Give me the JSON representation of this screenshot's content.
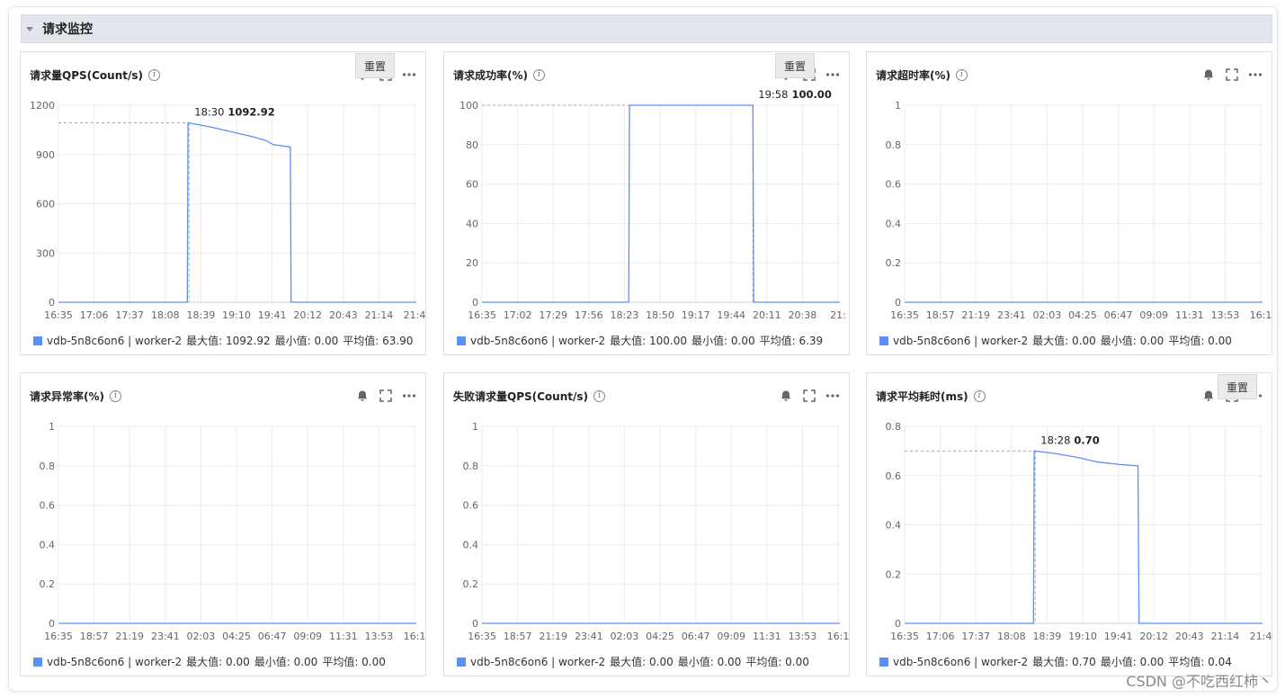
{
  "section": {
    "title": "请求监控"
  },
  "toolbar": {
    "icons": [
      "bell-icon",
      "fullscreen-icon",
      "more-icon"
    ]
  },
  "colors": {
    "series": "#5b8ff9",
    "grid": "#ebebeb",
    "axis": "#666666",
    "ref": "#aaaaaa"
  },
  "watermark": "CSDN @不吃西红柿丶",
  "panels": [
    {
      "title": "请求量QPS(Count/s)",
      "legend": {
        "series": "vdb-5n8c6on6 | worker-2",
        "max": "最大值: 1092.92",
        "min": "最小值: 0.00",
        "avg": "平均值: 63.90"
      },
      "reset": "重置",
      "tooltip": {
        "time": "18:30",
        "value": "1092.92"
      }
    },
    {
      "title": "请求成功率(%)",
      "legend": {
        "series": "vdb-5n8c6on6 | worker-2",
        "max": "最大值: 100.00",
        "min": "最小值: 0.00",
        "avg": "平均值: 6.39"
      },
      "reset": "重置",
      "tooltip": {
        "time": "19:58",
        "value": "100.00"
      }
    },
    {
      "title": "请求超时率(%)",
      "legend": {
        "series": "vdb-5n8c6on6 | worker-2",
        "max": "最大值: 0.00",
        "min": "最小值: 0.00",
        "avg": "平均值: 0.00"
      }
    },
    {
      "title": "请求异常率(%)",
      "legend": {
        "series": "vdb-5n8c6on6 | worker-2",
        "max": "最大值: 0.00",
        "min": "最小值: 0.00",
        "avg": "平均值: 0.00"
      }
    },
    {
      "title": "失败请求量QPS(Count/s)",
      "legend": {
        "series": "vdb-5n8c6on6 | worker-2",
        "max": "最大值: 0.00",
        "min": "最小值: 0.00",
        "avg": "平均值: 0.00"
      }
    },
    {
      "title": "请求平均耗时(ms)",
      "legend": {
        "series": "vdb-5n8c6on6 | worker-2",
        "max": "最大值: 0.70",
        "min": "最小值: 0.00",
        "avg": "平均值: 0.04"
      },
      "reset": "重置",
      "tooltip": {
        "time": "18:28",
        "value": "0.70"
      }
    }
  ],
  "chart_data": [
    {
      "type": "line",
      "title": "请求量QPS(Count/s)",
      "x": [
        "16:35",
        "17:06",
        "17:37",
        "18:08",
        "18:39",
        "19:10",
        "19:41",
        "20:12",
        "20:43",
        "21:14",
        "21:4"
      ],
      "yticks": [
        "0",
        "300",
        "600",
        "900",
        "1200"
      ],
      "ylim": [
        0,
        1200
      ],
      "series": [
        {
          "name": "vdb-5n8c6on6 | worker-2",
          "points": [
            [
              0,
              0
            ],
            [
              0.36,
              0
            ],
            [
              0.362,
              1092.92
            ],
            [
              0.42,
              1070
            ],
            [
              0.48,
              1040
            ],
            [
              0.54,
              1010
            ],
            [
              0.58,
              985
            ],
            [
              0.6,
              960
            ],
            [
              0.648,
              945
            ],
            [
              0.65,
              0
            ],
            [
              1,
              0
            ]
          ]
        }
      ],
      "ref": {
        "x": 0.365,
        "y": 1092.92
      }
    },
    {
      "type": "line",
      "title": "请求成功率(%)",
      "x": [
        "16:35",
        "17:02",
        "17:29",
        "17:56",
        "18:23",
        "18:50",
        "19:17",
        "19:44",
        "20:11",
        "20:38",
        "21:"
      ],
      "yticks": [
        "0",
        "20",
        "40",
        "60",
        "80",
        "100"
      ],
      "ylim": [
        0,
        100
      ],
      "series": [
        {
          "name": "vdb-5n8c6on6 | worker-2",
          "points": [
            [
              0,
              0
            ],
            [
              0.41,
              0
            ],
            [
              0.412,
              100
            ],
            [
              0.757,
              100
            ],
            [
              0.759,
              0
            ],
            [
              1,
              0
            ]
          ]
        }
      ],
      "ref": {
        "x": 0.757,
        "y": 100
      }
    },
    {
      "type": "line",
      "title": "请求超时率(%)",
      "x": [
        "16:35",
        "18:57",
        "21:19",
        "23:41",
        "02:03",
        "04:25",
        "06:47",
        "09:09",
        "11:31",
        "13:53",
        "16:1"
      ],
      "yticks": [
        "0",
        "0.2",
        "0.4",
        "0.6",
        "0.8",
        "1"
      ],
      "ylim": [
        0,
        1
      ],
      "series": [
        {
          "name": "vdb-5n8c6on6 | worker-2",
          "points": [
            [
              0,
              0
            ],
            [
              1,
              0
            ]
          ]
        }
      ]
    },
    {
      "type": "line",
      "title": "请求异常率(%)",
      "x": [
        "16:35",
        "18:57",
        "21:19",
        "23:41",
        "02:03",
        "04:25",
        "06:47",
        "09:09",
        "11:31",
        "13:53",
        "16:1"
      ],
      "yticks": [
        "0",
        "0.2",
        "0.4",
        "0.6",
        "0.8",
        "1"
      ],
      "ylim": [
        0,
        1
      ],
      "series": [
        {
          "name": "vdb-5n8c6on6 | worker-2",
          "points": [
            [
              0,
              0
            ],
            [
              1,
              0
            ]
          ]
        }
      ]
    },
    {
      "type": "line",
      "title": "失败请求量QPS(Count/s)",
      "x": [
        "16:35",
        "18:57",
        "21:19",
        "23:41",
        "02:03",
        "04:25",
        "06:47",
        "09:09",
        "11:31",
        "13:53",
        "16:1"
      ],
      "yticks": [
        "0",
        "0.2",
        "0.4",
        "0.6",
        "0.8",
        "1"
      ],
      "ylim": [
        0,
        1
      ],
      "series": [
        {
          "name": "vdb-5n8c6on6 | worker-2",
          "points": [
            [
              0,
              0
            ],
            [
              1,
              0
            ]
          ]
        }
      ]
    },
    {
      "type": "line",
      "title": "请求平均耗时(ms)",
      "x": [
        "16:35",
        "17:06",
        "17:37",
        "18:08",
        "18:39",
        "19:10",
        "19:41",
        "20:12",
        "20:43",
        "21:14",
        "21:4"
      ],
      "yticks": [
        "0",
        "0.2",
        "0.4",
        "0.6",
        "0.8"
      ],
      "ylim": [
        0,
        0.8
      ],
      "series": [
        {
          "name": "vdb-5n8c6on6 | worker-2",
          "points": [
            [
              0,
              0
            ],
            [
              0.36,
              0
            ],
            [
              0.362,
              0.7
            ],
            [
              0.42,
              0.69
            ],
            [
              0.48,
              0.675
            ],
            [
              0.54,
              0.655
            ],
            [
              0.6,
              0.645
            ],
            [
              0.652,
              0.64
            ],
            [
              0.655,
              0
            ],
            [
              1,
              0
            ]
          ]
        }
      ],
      "ref": {
        "x": 0.365,
        "y": 0.7
      }
    }
  ]
}
